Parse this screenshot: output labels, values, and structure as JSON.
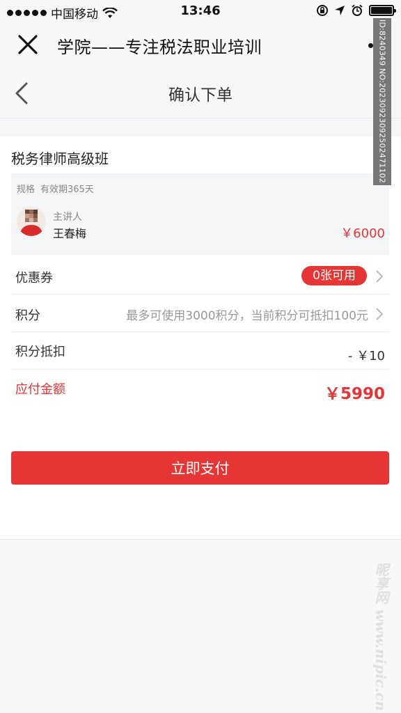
{
  "status_bar": {
    "carrier": "中国移动",
    "time": "13:46"
  },
  "wechat_header": {
    "title": "学院——专注税法职业培训"
  },
  "page_nav": {
    "title": "确认下单"
  },
  "course": {
    "title": "税务律师高级班",
    "spec_label": "规格",
    "spec_value": "有效期365天",
    "lecturer_label": "主讲人",
    "lecturer_name": "王春梅",
    "price": "￥6000"
  },
  "rows": {
    "coupon_label": "优惠券",
    "coupon_badge": "0张可用",
    "points_label": "积分",
    "points_hint": "最多可使用3000积分，当前积分可抵扣100元",
    "deduct_label": "积分抵扣",
    "deduct_value": "- ￥10",
    "payable_label": "应付金额",
    "payable_value": "￥5990"
  },
  "pay_button": "立即支付",
  "watermarks": {
    "id_text": "ID:8240349 NO:20230923092502471102",
    "site_text": "昵享网 www.nipic.cn"
  },
  "colors": {
    "accent_red": "#e53535",
    "background": "#f5f5f7"
  }
}
